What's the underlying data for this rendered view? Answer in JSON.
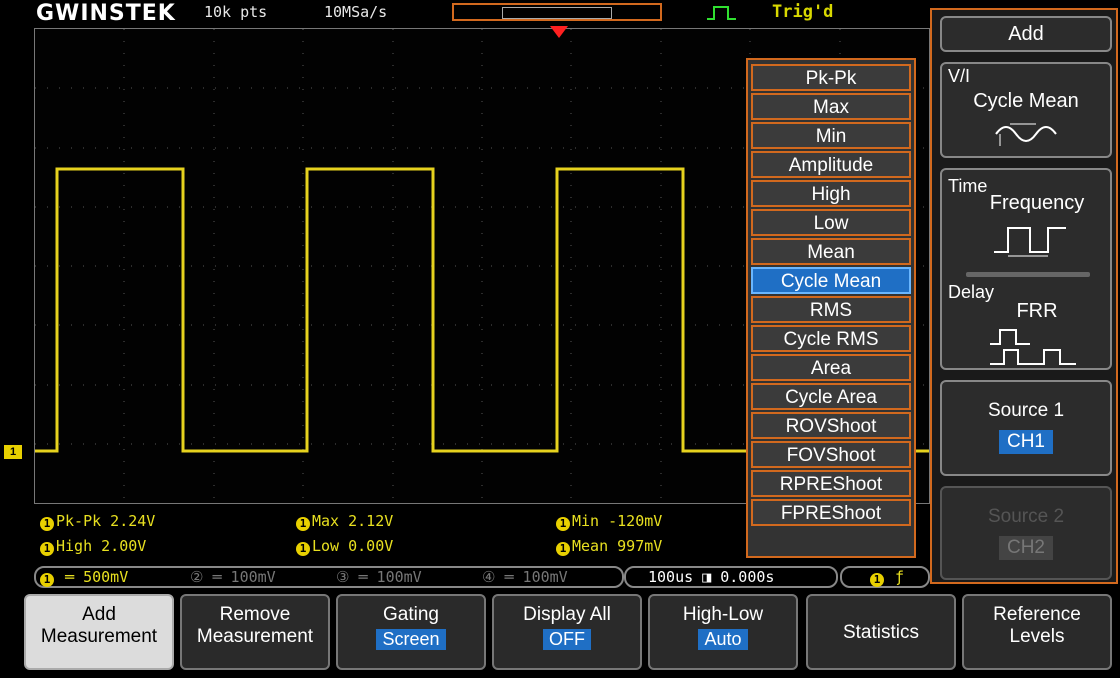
{
  "header": {
    "brand": "GWINSTEK",
    "record_length": "10k pts",
    "sample_rate": "10MSa/s",
    "trigger_status": "Trig'd"
  },
  "measurements": {
    "row1": [
      "Pk-Pk 2.24V",
      "Max 2.12V",
      "Min -120mV"
    ],
    "row2": [
      "High 2.00V",
      "Low 0.00V",
      "Mean 997mV"
    ]
  },
  "channel_bar": {
    "ch1": "500mV",
    "ch2": "100mV",
    "ch3": "100mV",
    "ch4": "100mV",
    "timebase": "100us",
    "position": "0.000s"
  },
  "measure_menu": {
    "items": [
      "Pk-Pk",
      "Max",
      "Min",
      "Amplitude",
      "High",
      "Low",
      "Mean",
      "Cycle Mean",
      "RMS",
      "Cycle RMS",
      "Area",
      "Cycle Area",
      "ROVShoot",
      "FOVShoot",
      "RPREShoot",
      "FPREShoot"
    ],
    "selected": "Cycle Mean"
  },
  "side_menu": {
    "title": "Add",
    "vi_label": "V/I",
    "vi_value": "Cycle Mean",
    "time_label": "Time",
    "time_value": "Frequency",
    "delay_label": "Delay",
    "delay_value": "FRR",
    "source1_label": "Source 1",
    "source1_value": "CH1",
    "source2_label": "Source 2",
    "source2_value": "CH2"
  },
  "bottom_menu": {
    "add_l1": "Add",
    "add_l2": "Measurement",
    "remove_l1": "Remove",
    "remove_l2": "Measurement",
    "gating_l1": "Gating",
    "gating_value": "Screen",
    "display_l1": "Display All",
    "display_value": "OFF",
    "highlow_l1": "High-Low",
    "highlow_value": "Auto",
    "statistics": "Statistics",
    "ref_l1": "Reference",
    "ref_l2": "Levels"
  },
  "colors": {
    "trace": "#e6d21e",
    "accent": "#d2691e",
    "selected": "#1f6fc5"
  }
}
